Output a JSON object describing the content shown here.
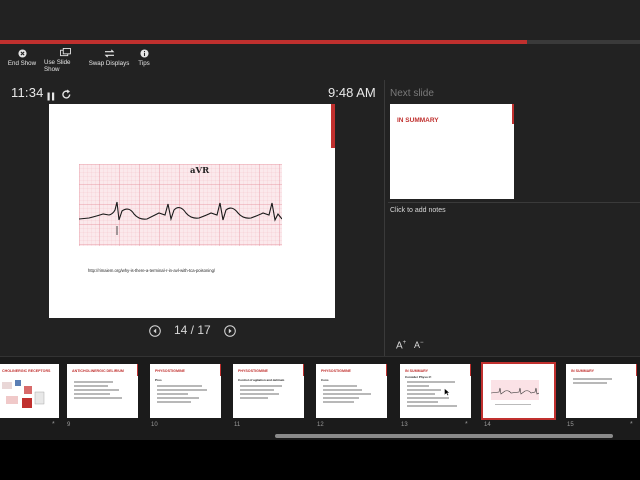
{
  "toolbar": {
    "end_show": "End Show",
    "use_slide_show": "Use Slide Show",
    "swap_displays": "Swap Displays",
    "tips": "Tips"
  },
  "presenter": {
    "timer": "11:34",
    "clock": "9:48 AM",
    "progress_fraction": 0.824
  },
  "current_slide": {
    "url": "http://rimaiem.org/why-is-there-a-terminal-r-in-avl-with-tca-poisoning/",
    "ekg_lead_label": "aVR"
  },
  "navigation": {
    "counter": "14 / 17"
  },
  "next_slide": {
    "label": "Next slide",
    "title": "IN SUMMARY"
  },
  "notes": {
    "placeholder": "Click to add notes"
  },
  "font_controls": {
    "increase": "A",
    "decrease": "A"
  },
  "colors": {
    "accent": "#c0302e",
    "background": "#222222"
  },
  "thumbnails": [
    {
      "number": "8",
      "title": "CHOLINERGIC RECEPTORS",
      "starred": true,
      "active": false
    },
    {
      "number": "9",
      "title": "ANTICHOLINERGIC DELIRIUM",
      "starred": false,
      "active": false
    },
    {
      "number": "10",
      "title": "PHYSOSTIGMINE",
      "subtitle": "Pros",
      "starred": false,
      "active": false
    },
    {
      "number": "11",
      "title": "PHYSOSTIGMINE",
      "subtitle": "Control of agitation and delirium",
      "starred": false,
      "active": false
    },
    {
      "number": "12",
      "title": "PHYSOSTIGMINE",
      "subtitle": "Cons",
      "starred": false,
      "active": false
    },
    {
      "number": "13",
      "title": "IN SUMMARY",
      "subtitle": "Consider Physo if:",
      "starred": true,
      "active": false
    },
    {
      "number": "14",
      "title": "",
      "starred": false,
      "active": true
    },
    {
      "number": "15",
      "title": "IN SUMMARY",
      "starred": true,
      "active": false
    }
  ]
}
